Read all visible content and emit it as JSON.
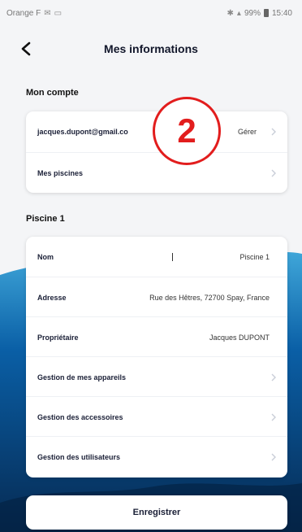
{
  "status_bar": {
    "carrier": "Orange F",
    "battery": "99%",
    "time": "15:40"
  },
  "header": {
    "title": "Mes informations",
    "back_icon": "chevron-left-icon"
  },
  "account_section": {
    "title": "Mon compte",
    "email": "jacques.dupont@gmail.co",
    "manage_label": "Gérer",
    "pools_label": "Mes piscines"
  },
  "callout": {
    "number": "2",
    "color": "#e21d1d"
  },
  "pool_section": {
    "title": "Piscine 1",
    "rows": [
      {
        "label": "Nom",
        "value": "Piscine 1"
      },
      {
        "label": "Adresse",
        "value": "Rue des Hêtres, 72700 Spay, France"
      },
      {
        "label": "Propriétaire",
        "value": "Jacques DUPONT"
      },
      {
        "label": "Gestion de mes appareils",
        "value": ""
      },
      {
        "label": "Gestion des accessoires",
        "value": ""
      },
      {
        "label": "Gestion des utilisateurs",
        "value": ""
      }
    ]
  },
  "save_button": {
    "label": "Enregistrer"
  },
  "colors": {
    "water_dark": "#062a52",
    "water_mid": "#0a5fa6",
    "water_light": "#3fa6d9",
    "background": "#f4f5f7"
  }
}
